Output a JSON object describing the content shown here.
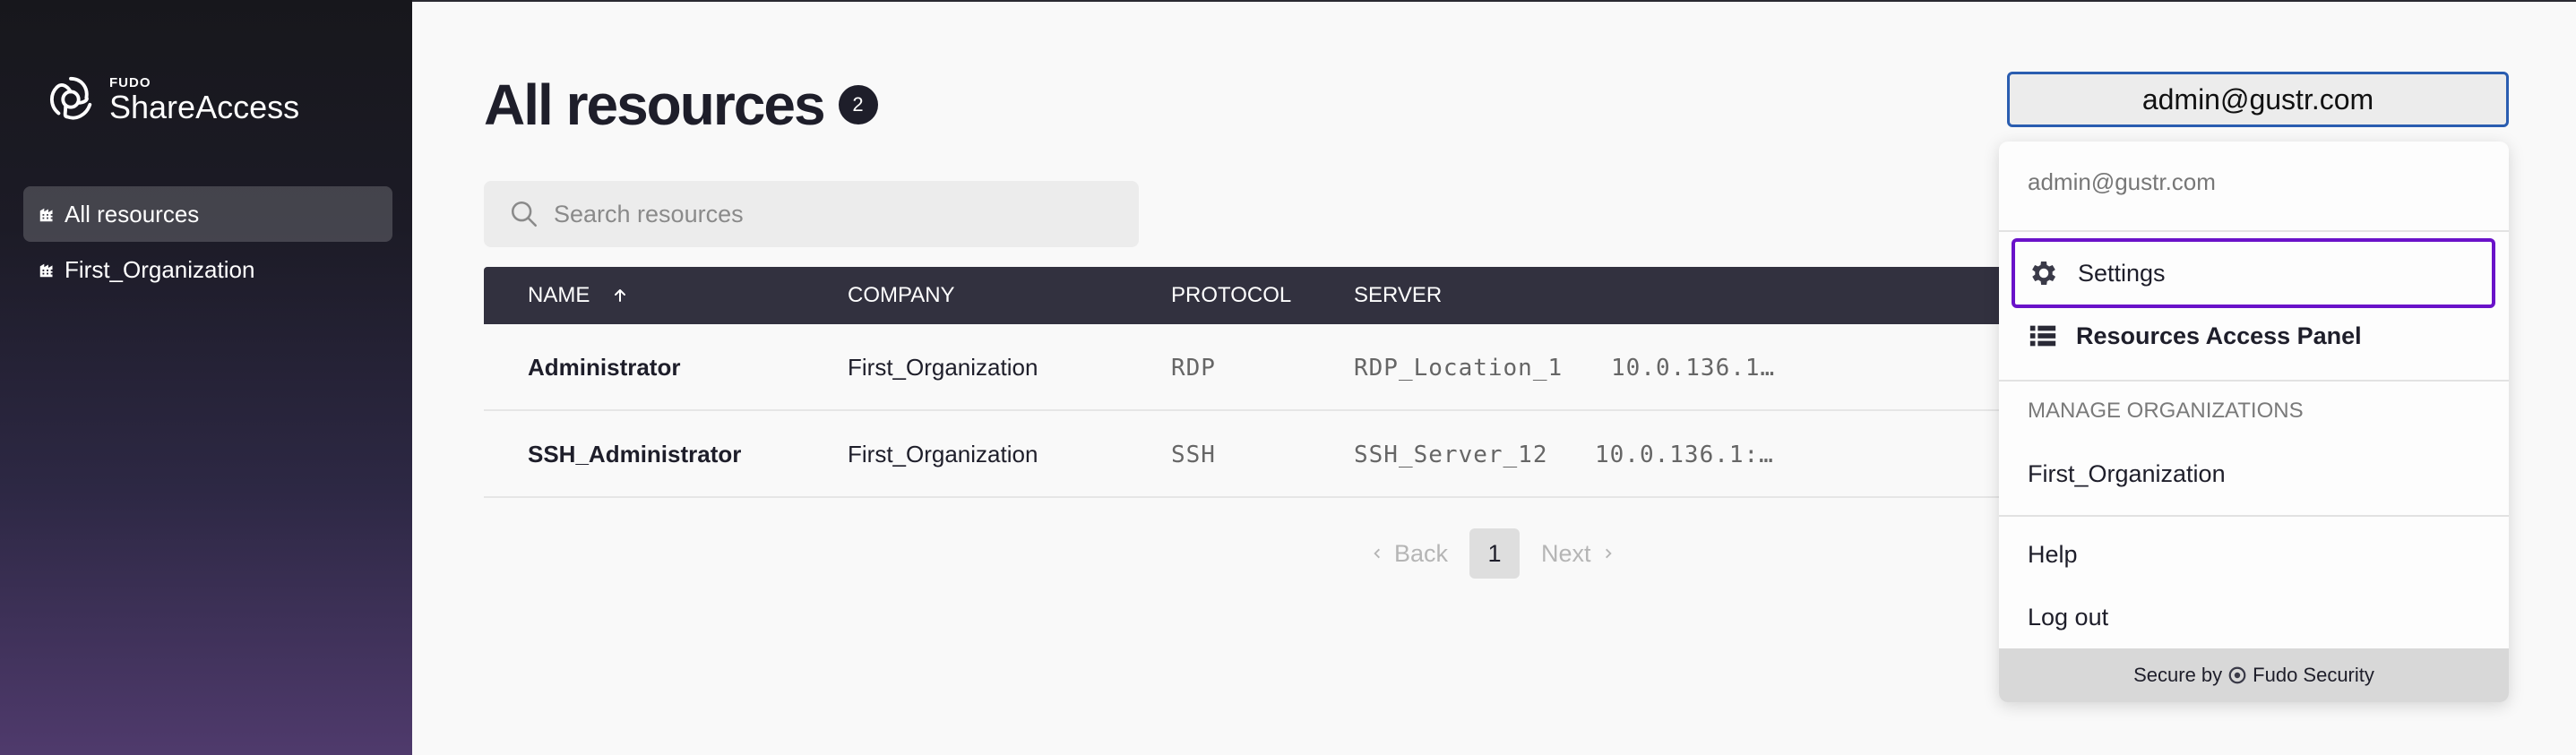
{
  "brand": {
    "small": "FUDO",
    "name": "ShareAccess"
  },
  "sidebar": {
    "items": [
      {
        "label": "All resources",
        "icon": "building-icon",
        "active": true
      },
      {
        "label": "First_Organization",
        "icon": "building-icon",
        "active": false
      }
    ]
  },
  "main": {
    "title": "All resources",
    "count": "2",
    "search": {
      "placeholder": "Search resources",
      "value": ""
    }
  },
  "table": {
    "columns": [
      "NAME",
      "COMPANY",
      "PROTOCOL",
      "SERVER"
    ],
    "sort_column": "NAME",
    "sort_direction": "ascending",
    "rows": [
      {
        "name": "Administrator",
        "company": "First_Organization",
        "protocol": "RDP",
        "server": "RDP_Location_1",
        "address": "10.0.136.1…"
      },
      {
        "name": "SSH_Administrator",
        "company": "First_Organization",
        "protocol": "SSH",
        "server": "SSH_Server_12",
        "address": "10.0.136.1:…"
      }
    ]
  },
  "pagination": {
    "back": "Back",
    "current": "1",
    "next": "Next"
  },
  "user": {
    "button_label": "admin@gustr.com",
    "menu": {
      "email": "admin@gustr.com",
      "settings": "Settings",
      "resources_panel": "Resources Access Panel",
      "manage_header": "MANAGE ORGANIZATIONS",
      "organization": "First_Organization",
      "help": "Help",
      "logout": "Log out",
      "footer_prefix": "Secure by",
      "footer_brand": "Fudo Security"
    }
  },
  "colors": {
    "focus_blue": "#2a5db0",
    "highlight_purple": "#6a12c9",
    "table_header": "#32313f",
    "sidebar_bottom": "#4f3a6c"
  }
}
